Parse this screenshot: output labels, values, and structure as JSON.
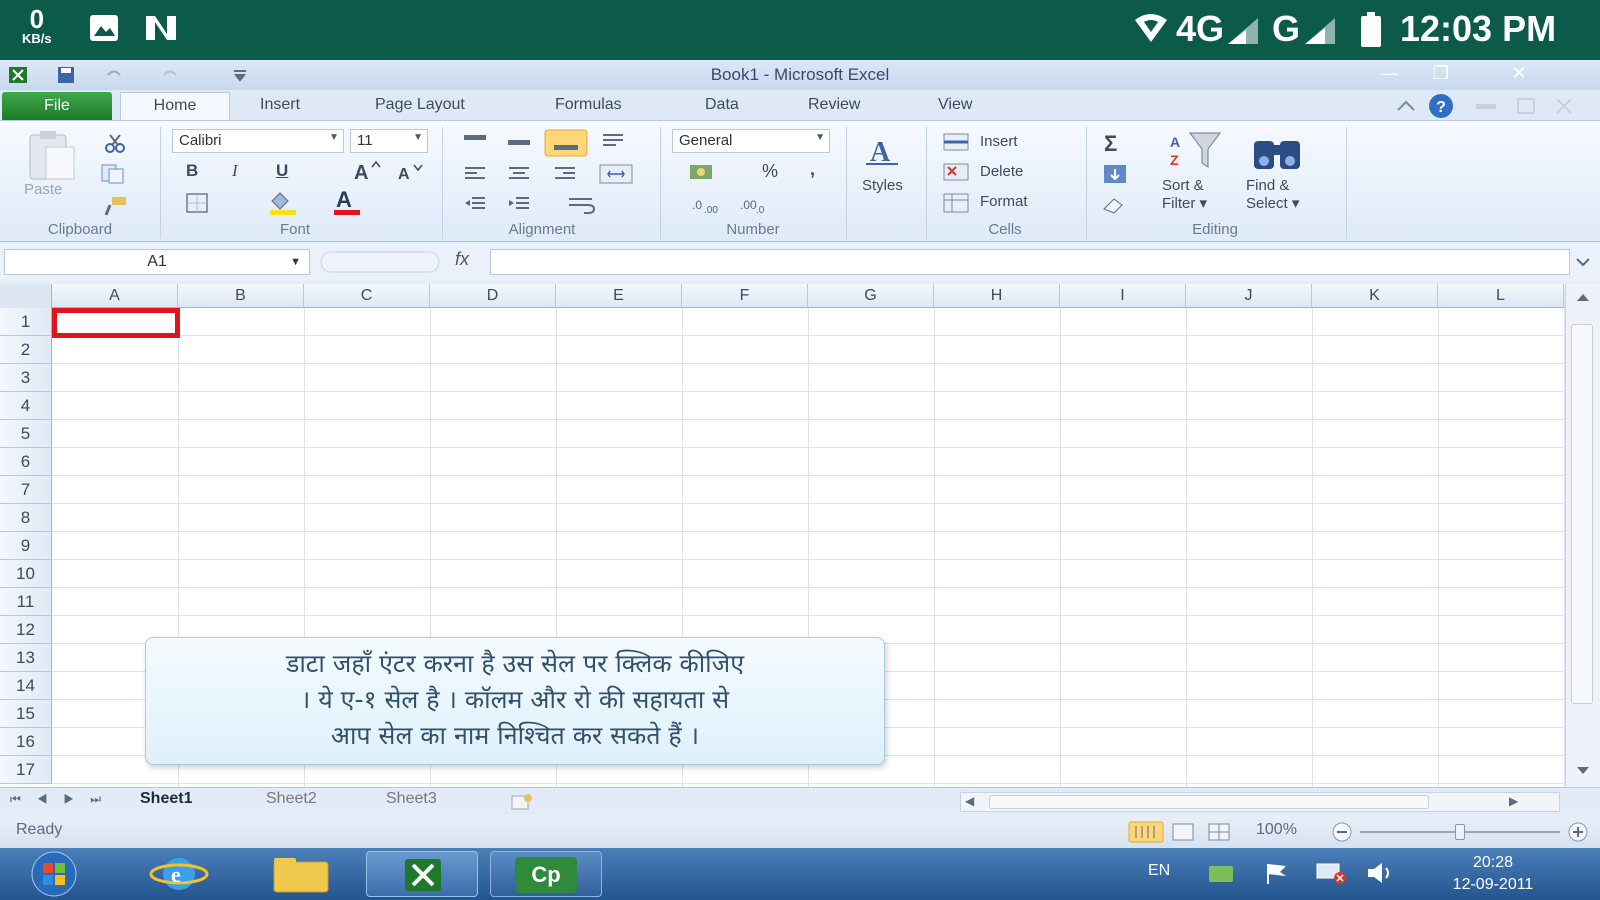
{
  "status_bar": {
    "speed_value": "0",
    "speed_unit": "KB/s",
    "network_1": "4G",
    "network_2": "G",
    "time": "12:03 PM"
  },
  "window": {
    "title": "Book1 - Microsoft Excel"
  },
  "tabs": [
    "File",
    "Home",
    "Insert",
    "Page Layout",
    "Formulas",
    "Data",
    "Review",
    "View"
  ],
  "ribbon": {
    "clipboard": {
      "label": "Clipboard",
      "paste": "Paste"
    },
    "font": {
      "label": "Font",
      "name": "Calibri",
      "size": "11",
      "bold": "B",
      "italic": "I",
      "underline": "U"
    },
    "alignment": {
      "label": "Alignment"
    },
    "number": {
      "label": "Number",
      "format": "General",
      "percent": "%"
    },
    "styles": {
      "label": "Styles"
    },
    "cells": {
      "label": "Cells",
      "insert": "Insert",
      "delete": "Delete",
      "format": "Format"
    },
    "editing": {
      "label": "Editing",
      "sort_line1": "Sort &",
      "sort_line2": "Filter",
      "find_line1": "Find &",
      "find_line2": "Select"
    }
  },
  "formula_bar": {
    "name_box": "A1",
    "fx": "fx"
  },
  "grid": {
    "columns": [
      "A",
      "B",
      "C",
      "D",
      "E",
      "F",
      "G",
      "H",
      "I",
      "J",
      "K",
      "L"
    ],
    "rows": [
      "1",
      "2",
      "3",
      "4",
      "5",
      "6",
      "7",
      "8",
      "9",
      "10",
      "11",
      "12",
      "13",
      "14",
      "15",
      "16",
      "17"
    ],
    "active_cell": "A1"
  },
  "callout": {
    "line1": "डाटा जहाँ एंटर करना है उस सेल पर क्लिक कीजिए",
    "line2": "। ये ए-१ सेल है । कॉलम और रो की सहायता से",
    "line3": "आप सेल का नाम निश्चित कर सकते हैं ।"
  },
  "sheets": [
    "Sheet1",
    "Sheet2",
    "Sheet3"
  ],
  "status": {
    "ready": "Ready",
    "zoom": "100%"
  },
  "taskbar": {
    "cp_label": "Cp",
    "lang": "EN",
    "clock_time": "20:28",
    "clock_date": "12-09-2011"
  },
  "colors": {
    "status_bar_bg": "#0b5a4a",
    "file_tab": "#2f9a3c",
    "active_cell_border": "#e0141e",
    "taskbar": "#2f639f"
  }
}
